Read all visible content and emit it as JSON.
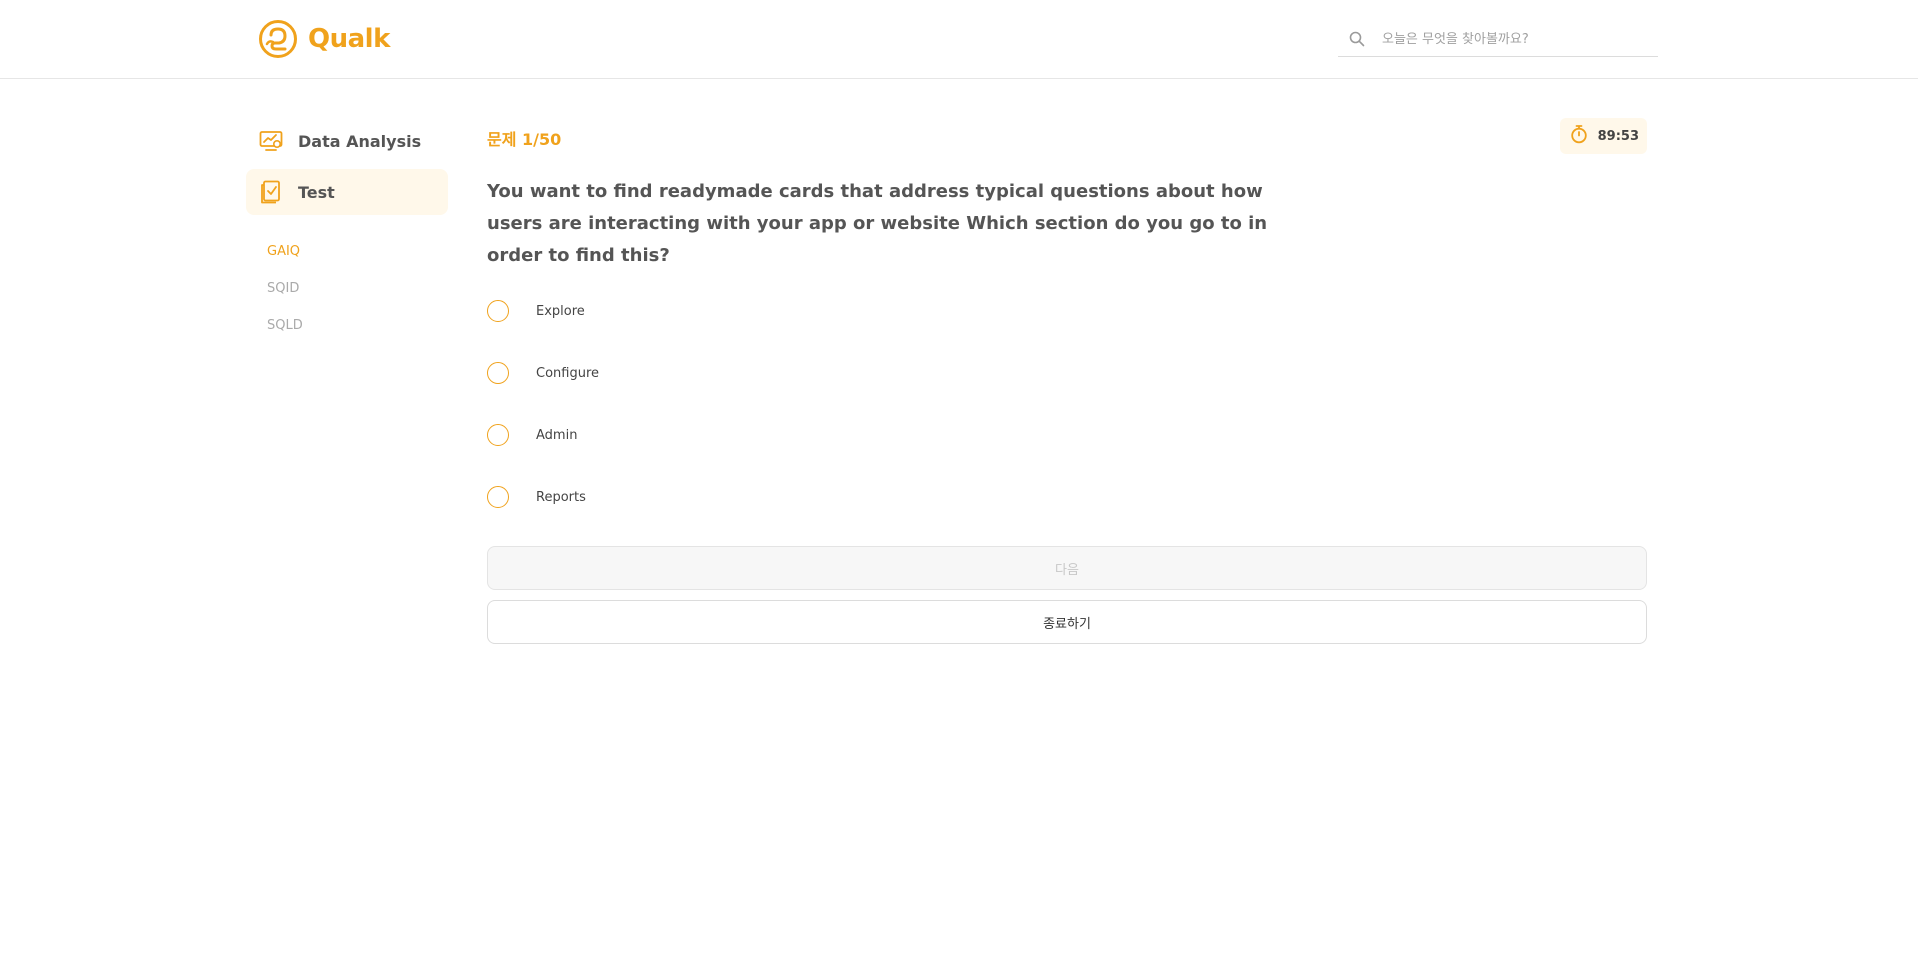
{
  "brand": {
    "name": "Qualk",
    "accent": "#f0a21c"
  },
  "search": {
    "placeholder": "오늘은 무엇을 찾아볼까요?"
  },
  "sidebar": {
    "items": [
      {
        "label": "Data Analysis",
        "icon": "chart-monitor-icon",
        "active": false
      },
      {
        "label": "Test",
        "icon": "checklist-icon",
        "active": true
      }
    ],
    "sub_items": [
      {
        "label": "GAIQ",
        "active": true
      },
      {
        "label": "SQID",
        "active": false
      },
      {
        "label": "SQLD",
        "active": false
      }
    ]
  },
  "quiz": {
    "counter": "문제 1/50",
    "timer": "89:53",
    "question": "You want to find readymade cards that address typical questions about how users are interacting with your app or website Which section do you go to in order to find this?",
    "options": [
      "Explore",
      "Configure",
      "Admin",
      "Reports"
    ]
  },
  "buttons": {
    "next": "다음",
    "end": "종료하기"
  }
}
